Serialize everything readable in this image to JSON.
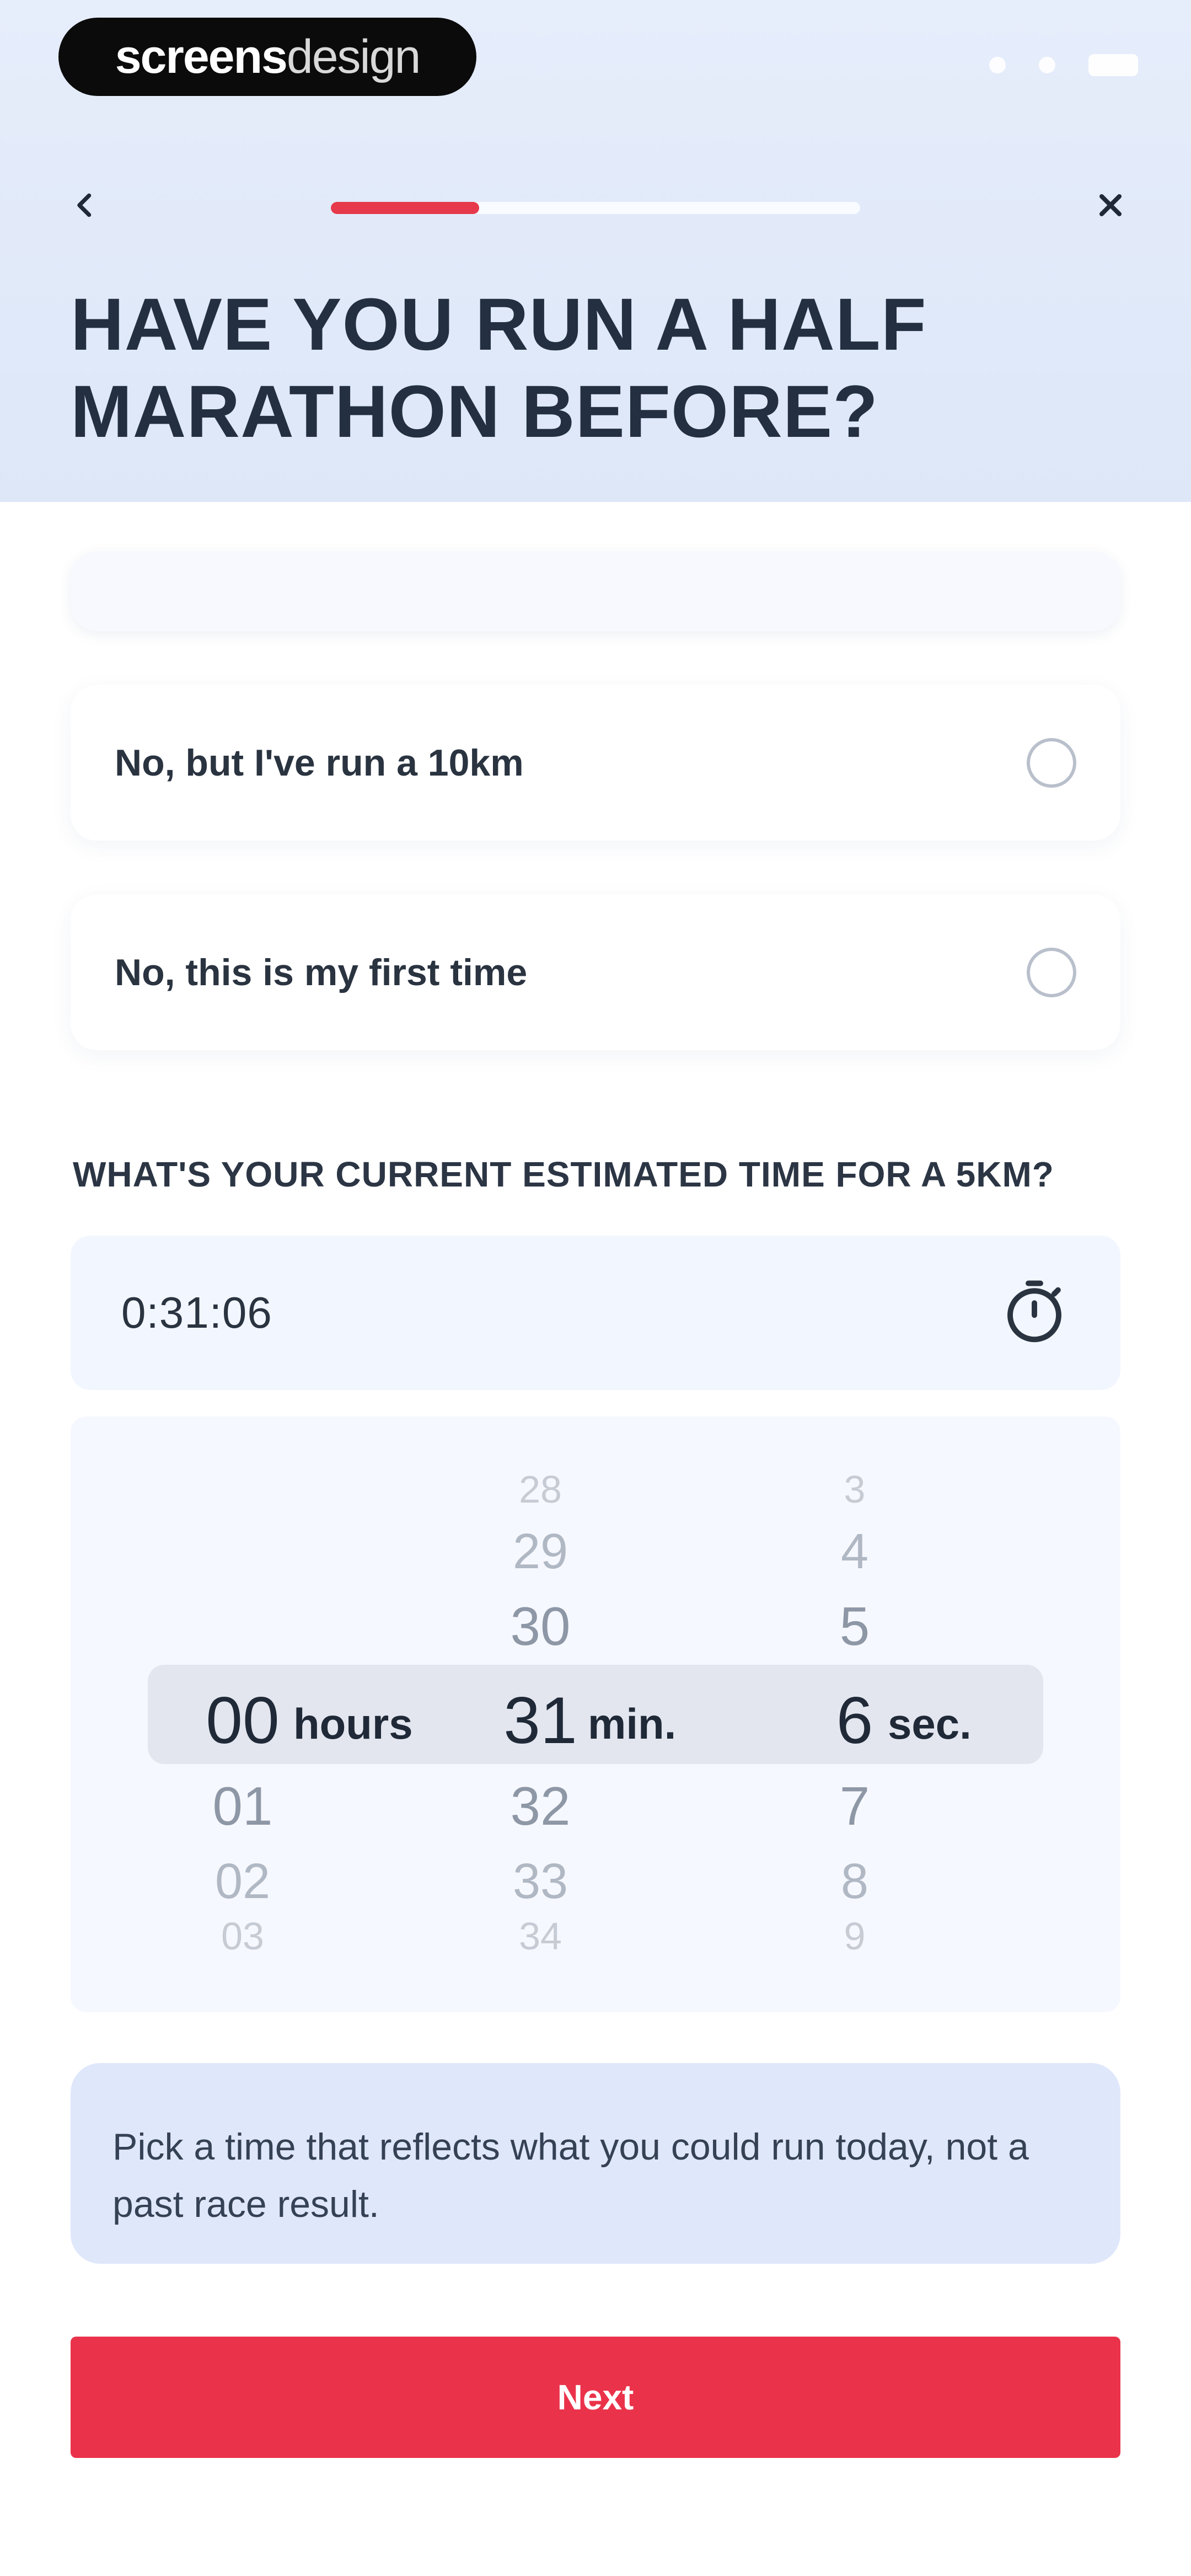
{
  "brand": {
    "bold": "screens",
    "light": "design"
  },
  "header": {
    "progress_percent": 28,
    "title": "HAVE YOU RUN A HALF MARATHON BEFORE?"
  },
  "options": [
    {
      "label": "No, but I've run a 10km"
    },
    {
      "label": "No, this is my first time"
    }
  ],
  "time_section": {
    "title": "WHAT'S YOUR CURRENT ESTIMATED TIME FOR A 5KM?",
    "value": "0:31:06"
  },
  "picker": {
    "hours": {
      "prev": [],
      "selected": "00",
      "next": [
        "01",
        "02",
        "03"
      ],
      "unit": "hours"
    },
    "minutes": {
      "prev": [
        "28",
        "29",
        "30"
      ],
      "selected": "31",
      "next": [
        "32",
        "33",
        "34"
      ],
      "unit": "min."
    },
    "seconds": {
      "prev": [
        "3",
        "4",
        "5"
      ],
      "selected": "6",
      "next": [
        "7",
        "8",
        "9"
      ],
      "unit": "sec."
    }
  },
  "hint": {
    "text": "Pick a time that reflects what you could run today, not a past race result."
  },
  "actions": {
    "next_label": "Next"
  },
  "colors": {
    "accent": "#ea334a",
    "hero_bg": "#e6edfb",
    "hint_bg": "#dfe7fb"
  }
}
